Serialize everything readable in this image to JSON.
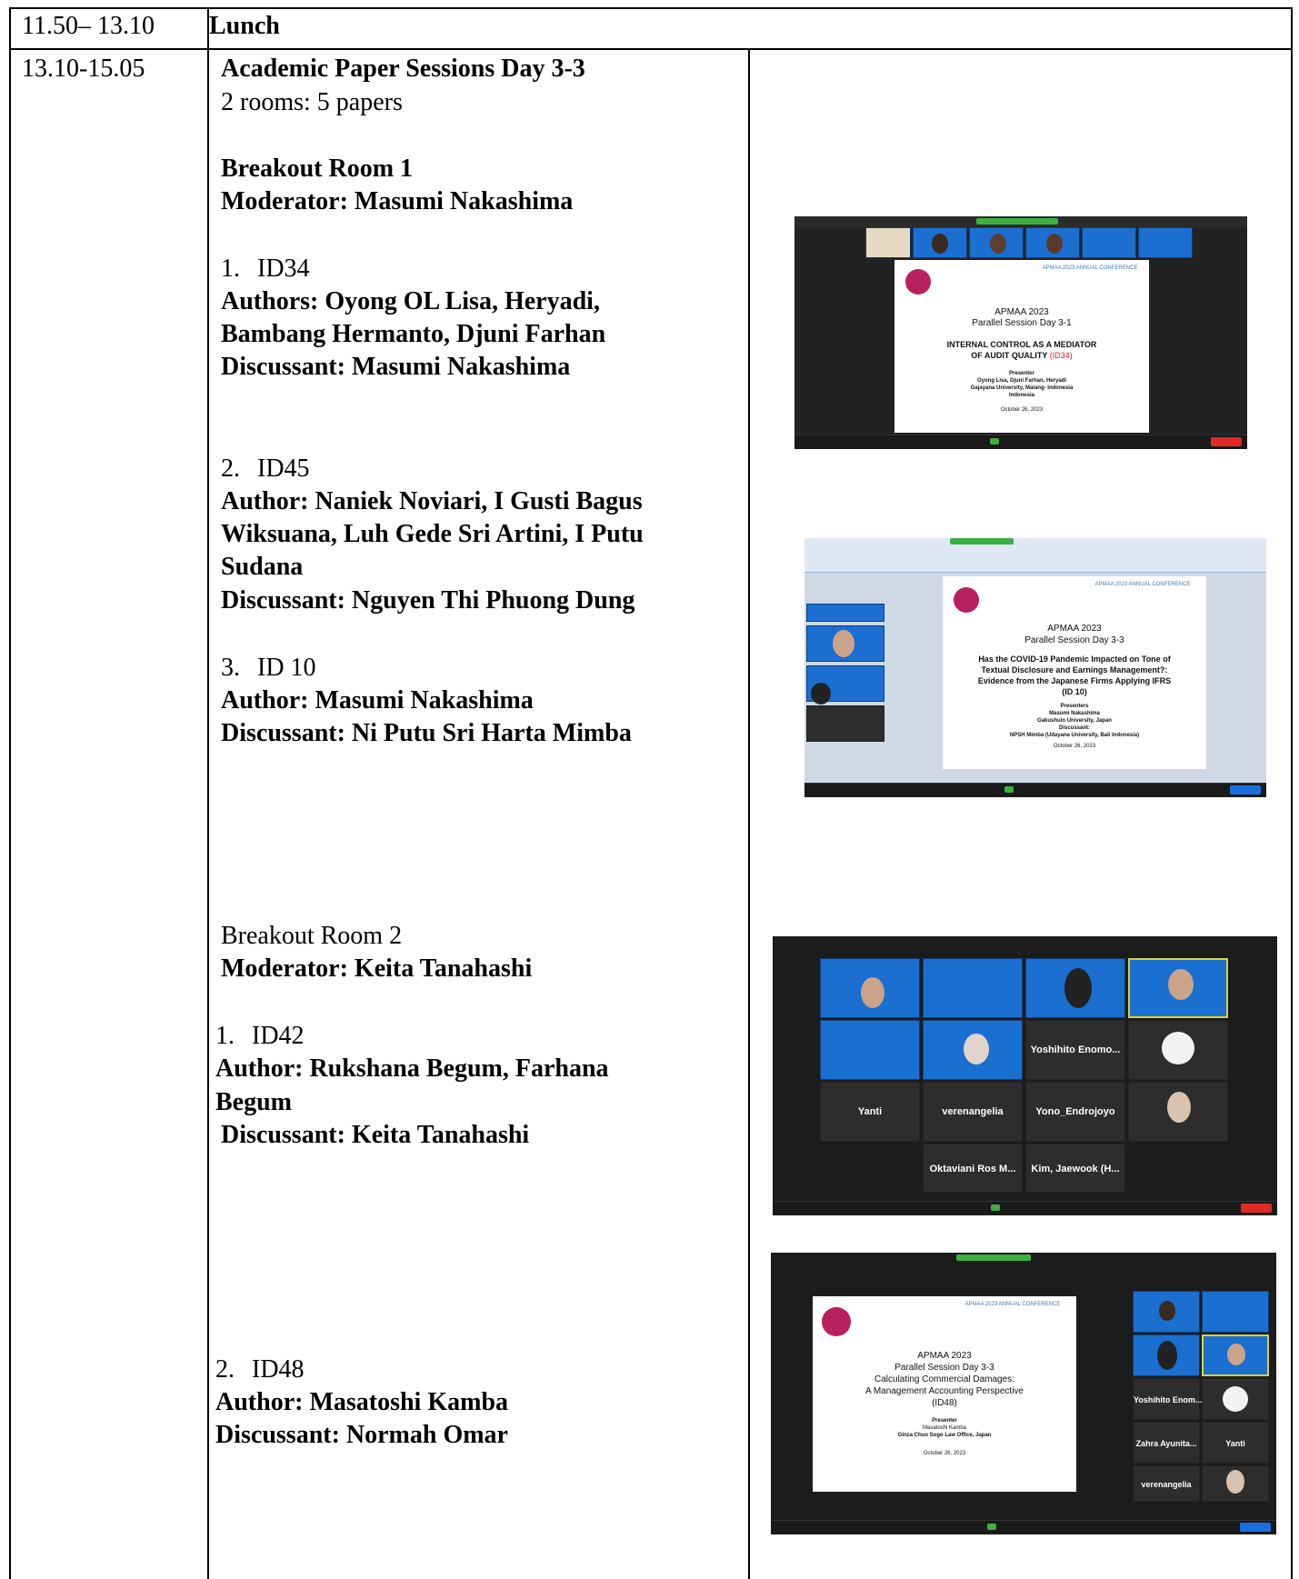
{
  "row_lunch": {
    "time": "11.50– 13.10",
    "label": "Lunch"
  },
  "row_sessions": {
    "time": "13.10-15.05",
    "title": "Academic Paper Sessions Day 3-3",
    "subtitle": "2 rooms: 5 papers",
    "room1": {
      "heading": "Breakout Room 1",
      "moderator": "Moderator: Masumi Nakashima",
      "papers": [
        {
          "num": "1.",
          "id": "ID34",
          "lines": [
            "Authors: Oyong OL Lisa, Heryadi,",
            "Bambang Hermanto, Djuni Farhan"
          ],
          "discussant": "Discussant: Masumi Nakashima"
        },
        {
          "num": "2.",
          "id": "ID45",
          "lines": [
            "Author: Naniek Noviari, I Gusti Bagus",
            "Wiksuana, Luh Gede Sri Artini, I Putu",
            "Sudana"
          ],
          "discussant": "Discussant: Nguyen Thi Phuong Dung"
        },
        {
          "num": "3.",
          "id": "ID 10",
          "lines": [
            "Author: Masumi Nakashima"
          ],
          "discussant": "Discussant: Ni Putu Sri Harta Mimba"
        }
      ]
    },
    "room2": {
      "heading": "Breakout Room 2",
      "moderator": "Moderator: Keita Tanahashi",
      "papers": [
        {
          "num": "1.",
          "id": "ID42",
          "lines": [
            "Author: Rukshana Begum, Farhana",
            "Begum"
          ],
          "discussant": "Discussant: Keita Tanahashi"
        },
        {
          "num": "2.",
          "id": "ID48",
          "lines": [
            "Author: Masatoshi Kamba"
          ],
          "discussant": "Discussant: Normah Omar"
        }
      ]
    }
  },
  "screenshots": {
    "s1": {
      "conference": "APMAA 2023 ANNUAL CONFERENCE",
      "title": "APMAA 2023",
      "session": "Parallel Session Day 3-1",
      "paper_a": "INTERNAL CONTROL AS A MEDIATOR",
      "paper_b": "OF AUDIT QUALITY",
      "paper_id": "(ID34)",
      "presenter_label": "Presenter",
      "presenters": "Oyong Lisa, Djuni Farhan, Heryadi",
      "affiliation": "Gajayana University, Malang- Indonesia",
      "country": "Indonesia",
      "date": "October 26, 2023"
    },
    "s2": {
      "conference": "APMAA 2023 ANNUAL CONFERENCE",
      "title": "APMAA 2023",
      "session": "Parallel Session Day 3-3",
      "line1": "Has the COVID-19 Pandemic Impacted on Tone of",
      "line2": "Textual Disclosure and Earnings Management?:",
      "line3": "Evidence from the Japanese Firms Applying IFRS",
      "line4": "(ID 10)",
      "presenters_label": "Presenters",
      "presenter": "Masumi Nakashima",
      "affiliation": "Gakushuin University, Japan",
      "discussant_label": "Discussant:",
      "discussant": "NPSH Mimba (Udayana University, Bali Indonesia)",
      "date": "October 26, 2023"
    },
    "s3": {
      "tiles": [
        "Yoshihito Enomo...",
        "Yanti",
        "verenangelia",
        "Yono_Endrojoyo",
        "Oktaviani Ros M...",
        "Kim, Jaewook (H..."
      ]
    },
    "s4": {
      "conference": "APMAA 2023 ANNUAL CONFERENCE",
      "title": "APMAA 2023",
      "session": "Parallel Session Day 3-3",
      "line1": "Calculating Commercial Damages:",
      "line2": "A Management Accounting Perspective",
      "line3": "(ID48)",
      "presenter_label": "Presenter",
      "presenter": "Masatoshi Kamba",
      "affiliation": "Ginza Chuo Sogo Law Office, Japan",
      "date": "October 26, 2023",
      "tiles": [
        "Yoshihito Enom...",
        "Zahra Ayunita...",
        "Yanti",
        "verenangelia"
      ]
    }
  },
  "colors": {
    "zoom_green": "#3cb043",
    "leave_red": "#e02828",
    "apmaa_magenta": "#b8205f",
    "tile_blue": "#1b6fd0"
  }
}
